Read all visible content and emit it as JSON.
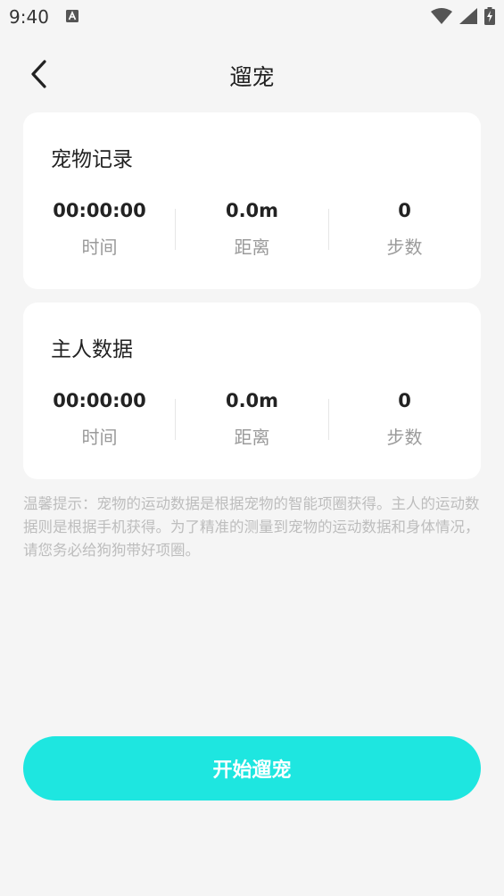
{
  "status_bar": {
    "time": "9:40"
  },
  "header": {
    "title": "遛宠"
  },
  "pet_record": {
    "title": "宠物记录",
    "stats": [
      {
        "value": "00:00:00",
        "label": "时间"
      },
      {
        "value": "0.0m",
        "label": "距离"
      },
      {
        "value": "0",
        "label": "步数"
      }
    ]
  },
  "owner_data": {
    "title": "主人数据",
    "stats": [
      {
        "value": "00:00:00",
        "label": "时间"
      },
      {
        "value": "0.0m",
        "label": "距离"
      },
      {
        "value": "0",
        "label": "步数"
      }
    ]
  },
  "tip": "温馨提示：宠物的运动数据是根据宠物的智能项圈获得。主人的运动数据则是根据手机获得。为了精准的测量到宠物的运动数据和身体情况，请您务必给狗狗带好项圈。",
  "start_button": "开始遛宠",
  "colors": {
    "accent": "#1ee6e0",
    "background": "#f5f5f5",
    "card": "#ffffff",
    "muted_text": "#9a9a9a",
    "tip_text": "#bdbdbd"
  },
  "icons": {
    "back": "chevron-left-icon",
    "status_app": "a-notification-icon",
    "wifi": "wifi-icon",
    "signal": "cell-signal-icon",
    "battery": "battery-charging-icon"
  }
}
